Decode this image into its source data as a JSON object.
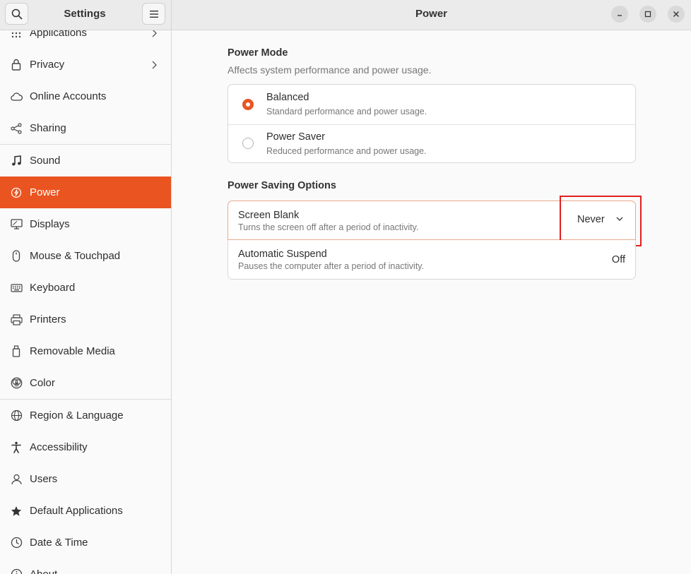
{
  "sidebar_header": {
    "title": "Settings"
  },
  "main_header": {
    "title": "Power"
  },
  "sidebar": {
    "items": [
      {
        "label": "Applications",
        "icon": "grid-icon"
      },
      {
        "label": "Privacy",
        "icon": "lock-icon"
      },
      {
        "label": "Online Accounts",
        "icon": "cloud-icon"
      },
      {
        "label": "Sharing",
        "icon": "share-icon"
      },
      {
        "label": "Sound",
        "icon": "music-note-icon"
      },
      {
        "label": "Power",
        "icon": "power-icon"
      },
      {
        "label": "Displays",
        "icon": "display-icon"
      },
      {
        "label": "Mouse & Touchpad",
        "icon": "mouse-icon"
      },
      {
        "label": "Keyboard",
        "icon": "keyboard-icon"
      },
      {
        "label": "Printers",
        "icon": "printer-icon"
      },
      {
        "label": "Removable Media",
        "icon": "usb-icon"
      },
      {
        "label": "Color",
        "icon": "color-icon"
      },
      {
        "label": "Region & Language",
        "icon": "globe-icon"
      },
      {
        "label": "Accessibility",
        "icon": "accessibility-icon"
      },
      {
        "label": "Users",
        "icon": "users-icon"
      },
      {
        "label": "Default Applications",
        "icon": "star-icon"
      },
      {
        "label": "Date & Time",
        "icon": "clock-icon"
      },
      {
        "label": "About",
        "icon": "info-icon"
      }
    ],
    "active_item": "Power",
    "accent_color": "#e95420"
  },
  "power_mode": {
    "title": "Power Mode",
    "subtitle": "Affects system performance and power usage.",
    "options": [
      {
        "title": "Balanced",
        "subtitle": "Standard performance and power usage.",
        "selected": true
      },
      {
        "title": "Power Saver",
        "subtitle": "Reduced performance and power usage.",
        "selected": false
      }
    ]
  },
  "power_saving": {
    "title": "Power Saving Options",
    "screen_blank": {
      "title": "Screen Blank",
      "subtitle": "Turns the screen off after a period of inactivity.",
      "value": "Never"
    },
    "automatic_suspend": {
      "title": "Automatic Suspend",
      "subtitle": "Pauses the computer after a period of inactivity.",
      "value": "Off"
    }
  }
}
